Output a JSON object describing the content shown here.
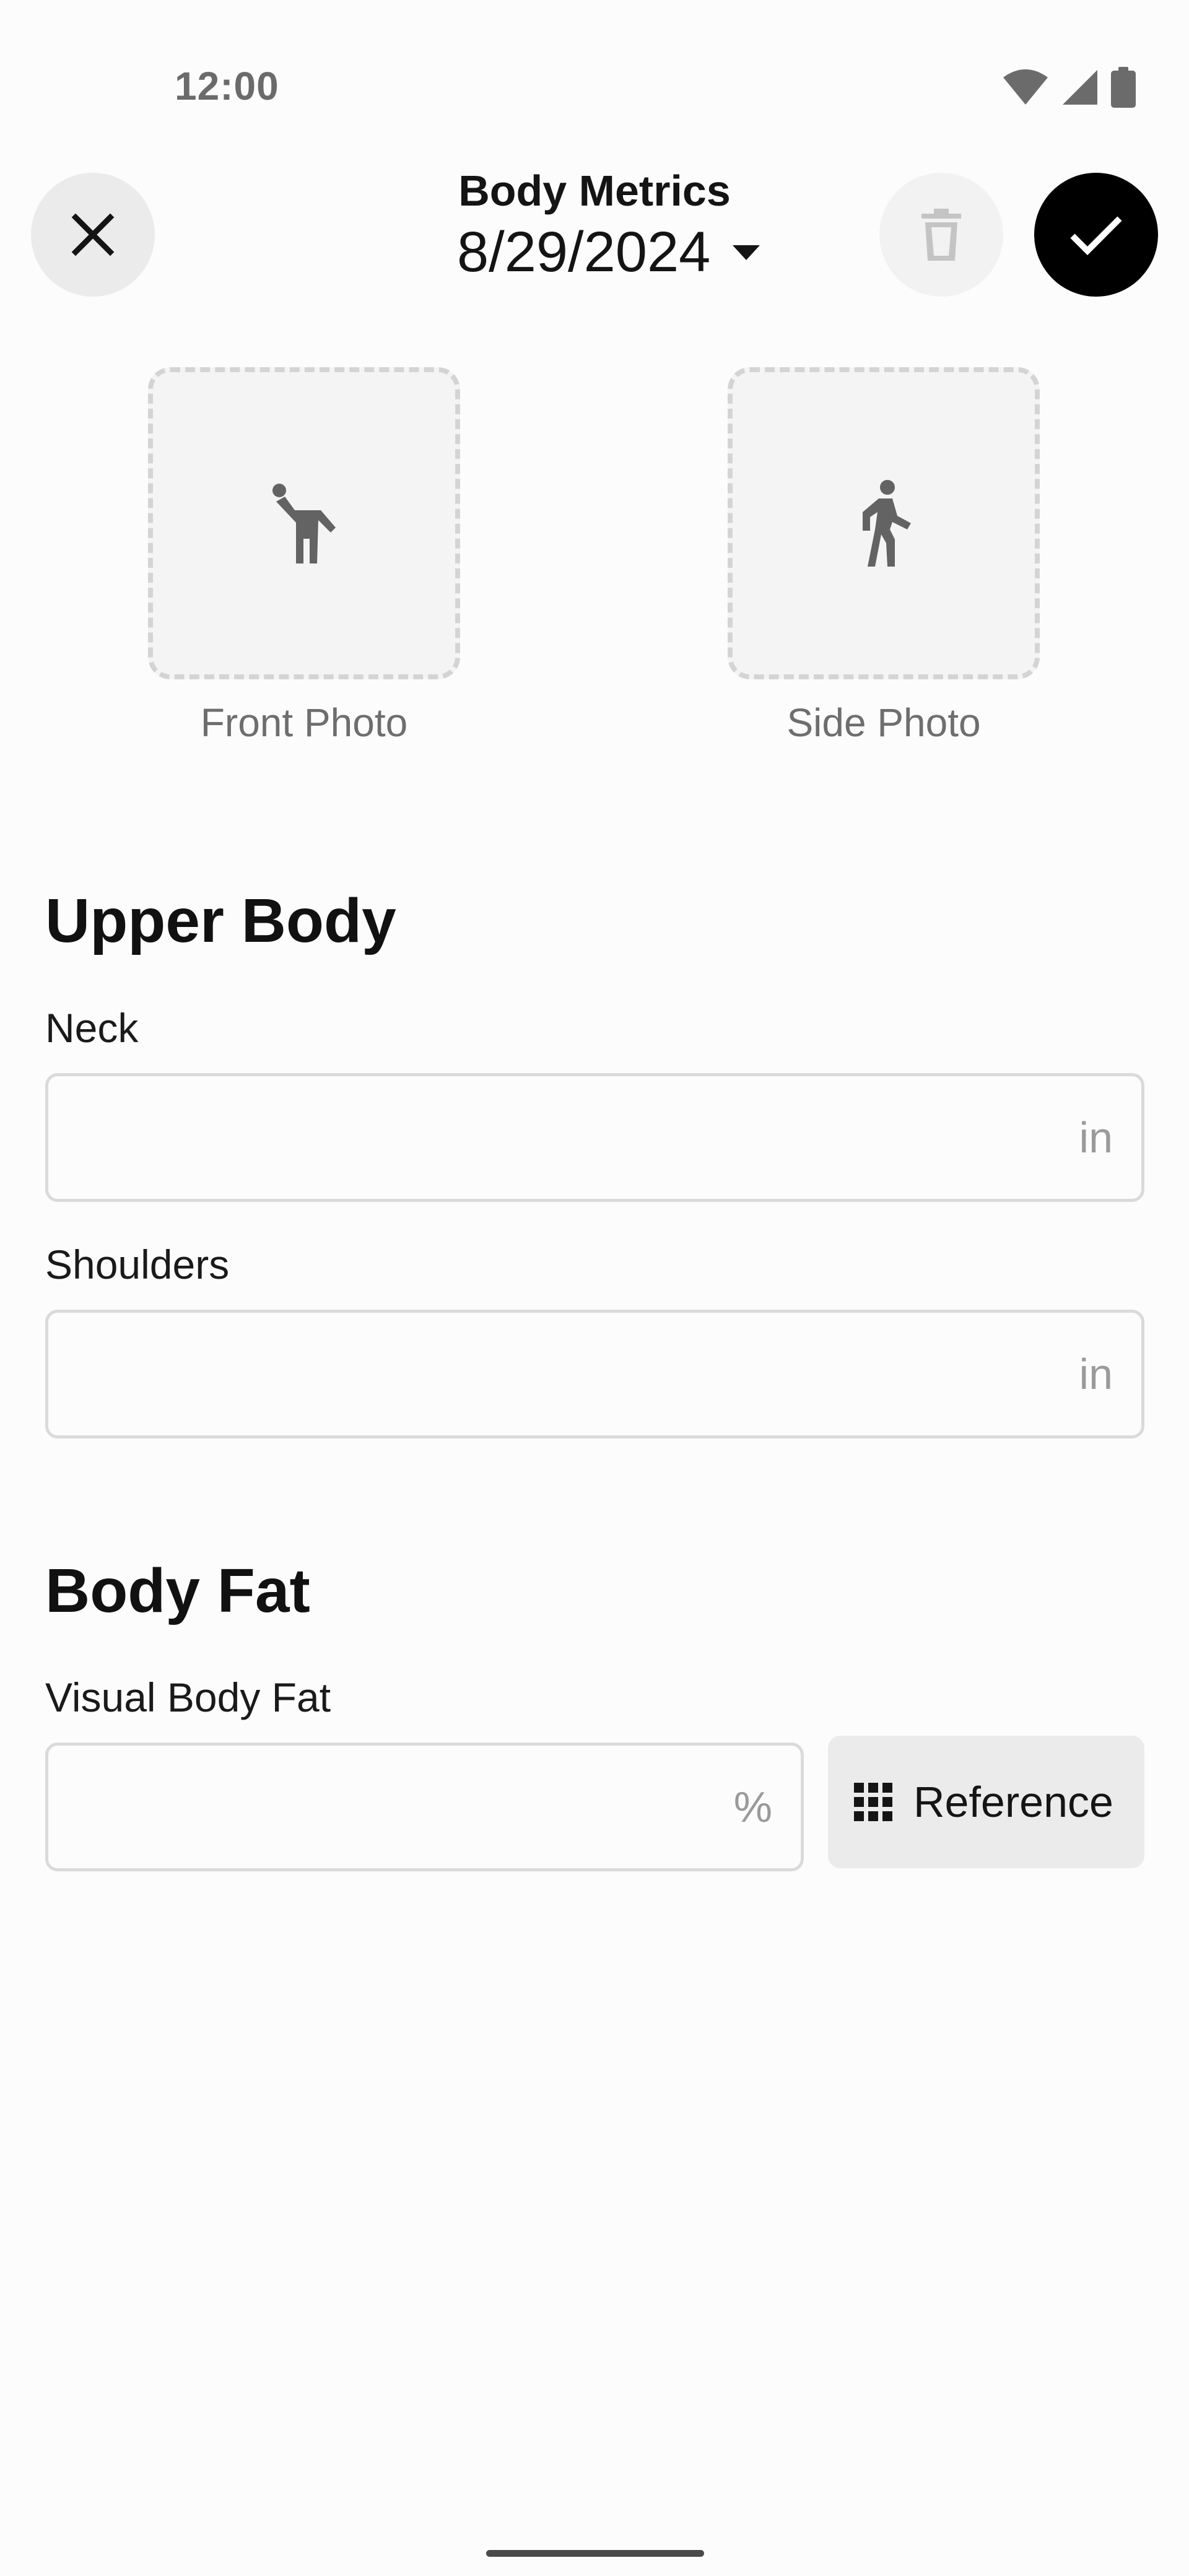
{
  "status_bar": {
    "time": "12:00",
    "icons": [
      "wifi-icon",
      "cellular-signal-icon",
      "battery-icon"
    ]
  },
  "header": {
    "title": "Body Metrics",
    "date": "8/29/2024",
    "icons": {
      "close": "close-icon",
      "date_dropdown": "dropdown-arrow-icon",
      "delete": "trash-icon",
      "confirm": "checkmark-icon"
    }
  },
  "photos": {
    "front_label": "Front Photo",
    "side_label": "Side Photo",
    "icons": {
      "front": "person-front-icon",
      "side": "person-walking-icon"
    }
  },
  "upper_body": {
    "title": "Upper Body",
    "neck": {
      "label": "Neck",
      "value": "",
      "unit": "in"
    },
    "shoulders": {
      "label": "Shoulders",
      "value": "",
      "unit": "in"
    }
  },
  "body_fat": {
    "title": "Body Fat",
    "visual": {
      "label": "Visual Body Fat",
      "value": "",
      "unit": "%"
    },
    "reference_label": "Reference",
    "reference_icon": "grid-icon"
  },
  "colors": {
    "confirm_bg": "#000000",
    "button_bg": "#ebebeb",
    "disabled_icon": "#c4c4c4",
    "muted_text": "#6e6e6e"
  }
}
